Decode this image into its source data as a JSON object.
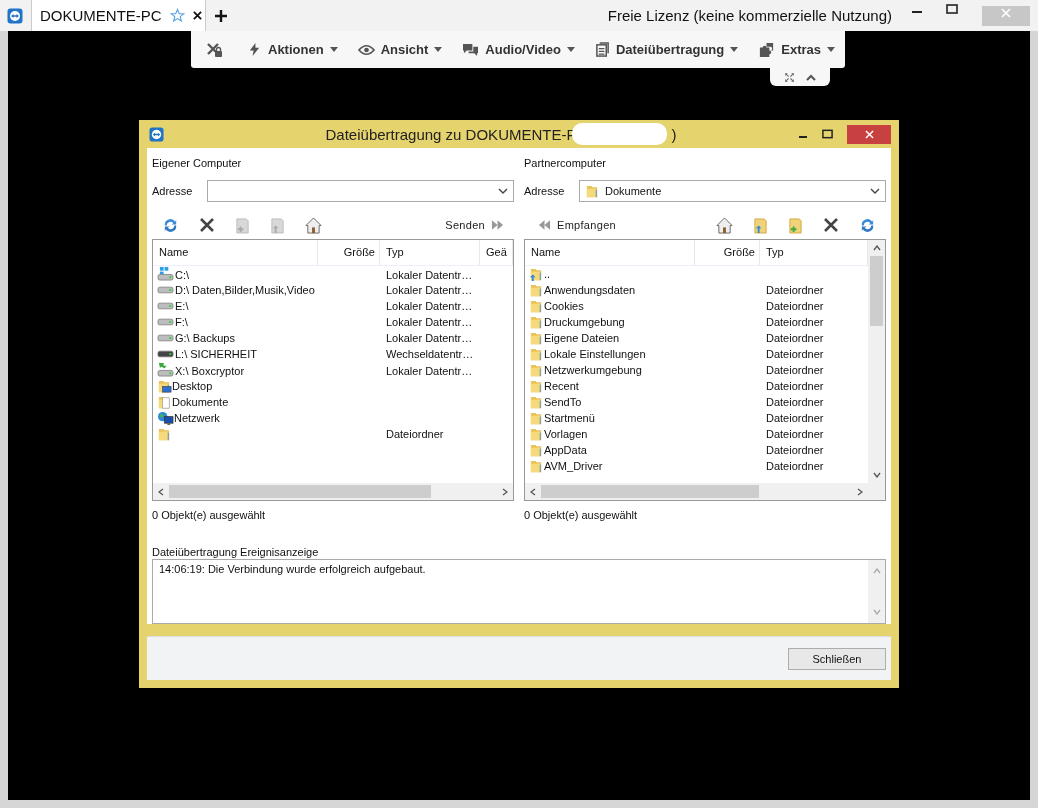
{
  "tab": {
    "title": "DOKUMENTE-PC",
    "favorite": false
  },
  "license": "Freie Lizenz (keine kommerzielle Nutzung)",
  "toolbar": [
    "Aktionen",
    "Ansicht",
    "Audio/Video",
    "Dateiübertragung",
    "Extras"
  ],
  "dialog": {
    "title": "Dateiübertragung zu DOKUMENTE-P",
    "title_end": ")",
    "local": {
      "heading": "Eigener Computer",
      "address_label": "Adresse",
      "action": "Senden",
      "columns": [
        "Name",
        "Größe",
        "Typ",
        "Geä"
      ],
      "rows": [
        {
          "kind": "system-drive",
          "name": "C:\\",
          "type": "Lokaler Datentr…"
        },
        {
          "kind": "drive",
          "name": "D:\\  Daten,Bilder,Musik,Video",
          "type": "Lokaler Datentr…"
        },
        {
          "kind": "drive",
          "name": "E:\\",
          "type": "Lokaler Datentr…"
        },
        {
          "kind": "drive",
          "name": "F:\\",
          "type": "Lokaler Datentr…"
        },
        {
          "kind": "drive",
          "name": "G:\\  Backups",
          "type": "Lokaler Datentr…"
        },
        {
          "kind": "removable-drive",
          "name": "L:\\  SICHERHEIT",
          "type": "Wechseldatentr…"
        },
        {
          "kind": "encrypted-drive",
          "name": "X:\\  Boxcryptor",
          "type": "Lokaler Datentr…"
        },
        {
          "kind": "desktop-folder",
          "name": "Desktop"
        },
        {
          "kind": "documents-folder",
          "name": "Dokumente"
        },
        {
          "kind": "network",
          "name": "Netzwerk"
        },
        {
          "kind": "folder",
          "type": "Dateiordner"
        }
      ],
      "status": "0 Objekt(e) ausgewählt"
    },
    "partner": {
      "heading": "Partnercomputer",
      "address_label": "Adresse",
      "address_value": "Dokumente",
      "action": "Empfangen",
      "columns": [
        "Name",
        "Größe",
        "Typ"
      ],
      "rows": [
        {
          "kind": "up-folder",
          "name": ".."
        },
        {
          "kind": "folder",
          "name": "Anwendungsdaten",
          "type": "Dateiordner"
        },
        {
          "kind": "folder",
          "name": "Cookies",
          "type": "Dateiordner"
        },
        {
          "kind": "folder",
          "name": "Druckumgebung",
          "type": "Dateiordner"
        },
        {
          "kind": "folder",
          "name": "Eigene Dateien",
          "type": "Dateiordner"
        },
        {
          "kind": "folder",
          "name": "Lokale Einstellungen",
          "type": "Dateiordner"
        },
        {
          "kind": "folder",
          "name": "Netzwerkumgebung",
          "type": "Dateiordner"
        },
        {
          "kind": "folder",
          "name": "Recent",
          "type": "Dateiordner"
        },
        {
          "kind": "folder",
          "name": "SendTo",
          "type": "Dateiordner"
        },
        {
          "kind": "folder",
          "name": "Startmenü",
          "type": "Dateiordner"
        },
        {
          "kind": "folder",
          "name": "Vorlagen",
          "type": "Dateiordner"
        },
        {
          "kind": "folder",
          "name": "AppData",
          "type": "Dateiordner"
        },
        {
          "kind": "folder",
          "name": "AVM_Driver",
          "type": "Dateiordner"
        }
      ],
      "status": "0 Objekt(e) ausgewählt"
    },
    "log": {
      "label": "Dateiübertragung Ereignisanzeige",
      "entries": [
        "14:06:19: Die Verbindung wurde erfolgreich aufgebaut."
      ]
    },
    "close_button": "Schließen"
  }
}
